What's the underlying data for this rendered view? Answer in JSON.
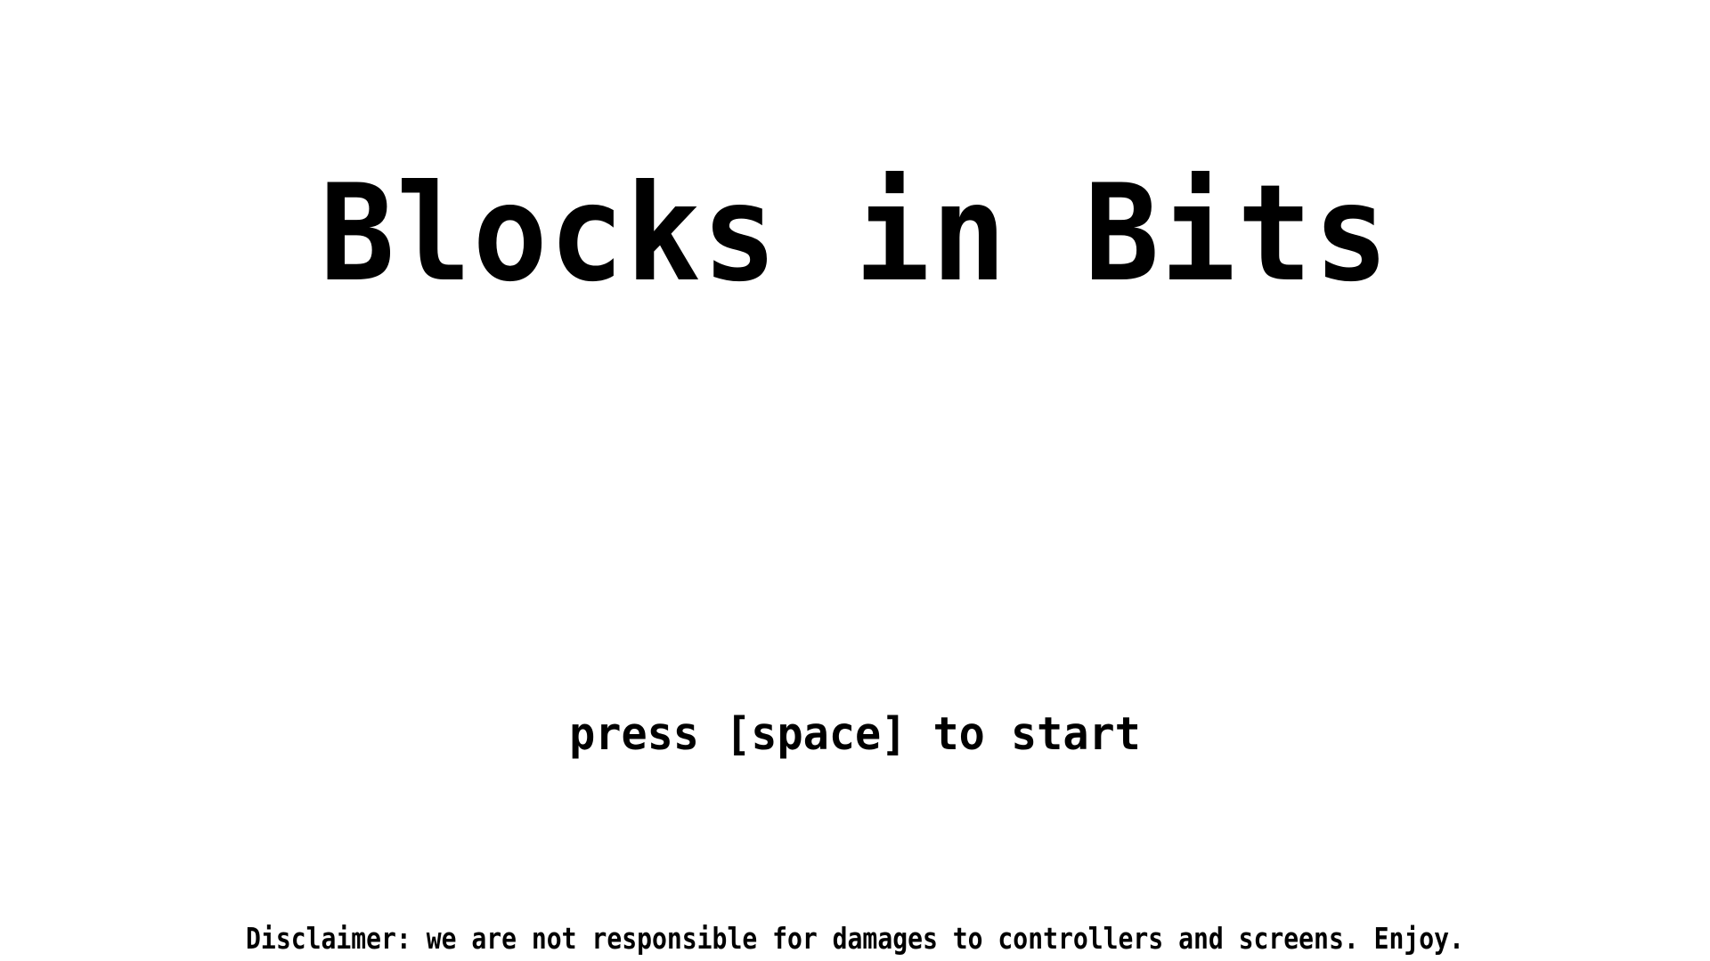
{
  "game": {
    "title": "Blocks in Bits",
    "prompt": "press [space] to start",
    "disclaimer": "Disclaimer: we are not responsible for damages to controllers and screens. Enjoy."
  },
  "colors": {
    "background": "#ffffff",
    "text": "#000000"
  }
}
